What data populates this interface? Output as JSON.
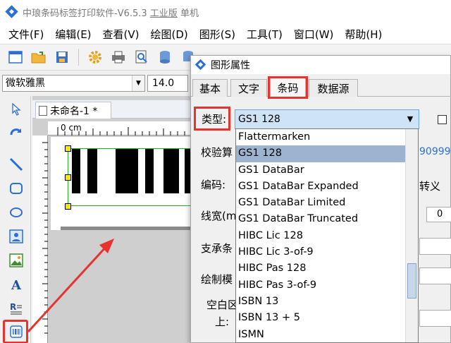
{
  "window": {
    "title_main": "中琅条码标签打印软件-V6.5.3 ",
    "title_edition": "工业版",
    "title_suffix": " 单机"
  },
  "menu": [
    "文件(F)",
    "编辑(E)",
    "查看(V)",
    "绘图(D)",
    "图形(S)",
    "工具(T)",
    "窗口(W)",
    "帮助(H)"
  ],
  "fontbar": {
    "font": "微软雅黑",
    "size": "14.0"
  },
  "document": {
    "tab": "未命名-1 *",
    "ruler_label": "0 cm"
  },
  "dialog": {
    "title": "图形属性",
    "tabs": [
      "基本",
      "文字",
      "条码",
      "数据源"
    ],
    "type_label": "类型:",
    "type_value": "GS1 128",
    "labels": {
      "checksum": "校验算",
      "encoding": "编码:",
      "line_width": "线宽(m",
      "bearer": "支承条",
      "draw_mode": "绘制模",
      "quiet_zone": "空白区",
      "top": "上:"
    },
    "right_values": {
      "number": "90999",
      "escape": "转义",
      "spin": "0"
    },
    "options": [
      "Flattermarken",
      "GS1 128",
      "GS1 DataBar",
      "GS1 DataBar Expanded",
      "GS1 DataBar Limited",
      "GS1 DataBar Truncated",
      "HIBC Lic 128",
      "HIBC Lic 3-of-9",
      "HIBC Pas 128",
      "HIBC Pas 3-of-9",
      "ISBN 13",
      "ISBN 13 + 5",
      "ISMN"
    ],
    "selected_option": "GS1 128"
  },
  "colors": {
    "highlight_red": "#e5342f",
    "selection_blue": "#9db4d1",
    "accent_blue": "#2b6fd6"
  }
}
